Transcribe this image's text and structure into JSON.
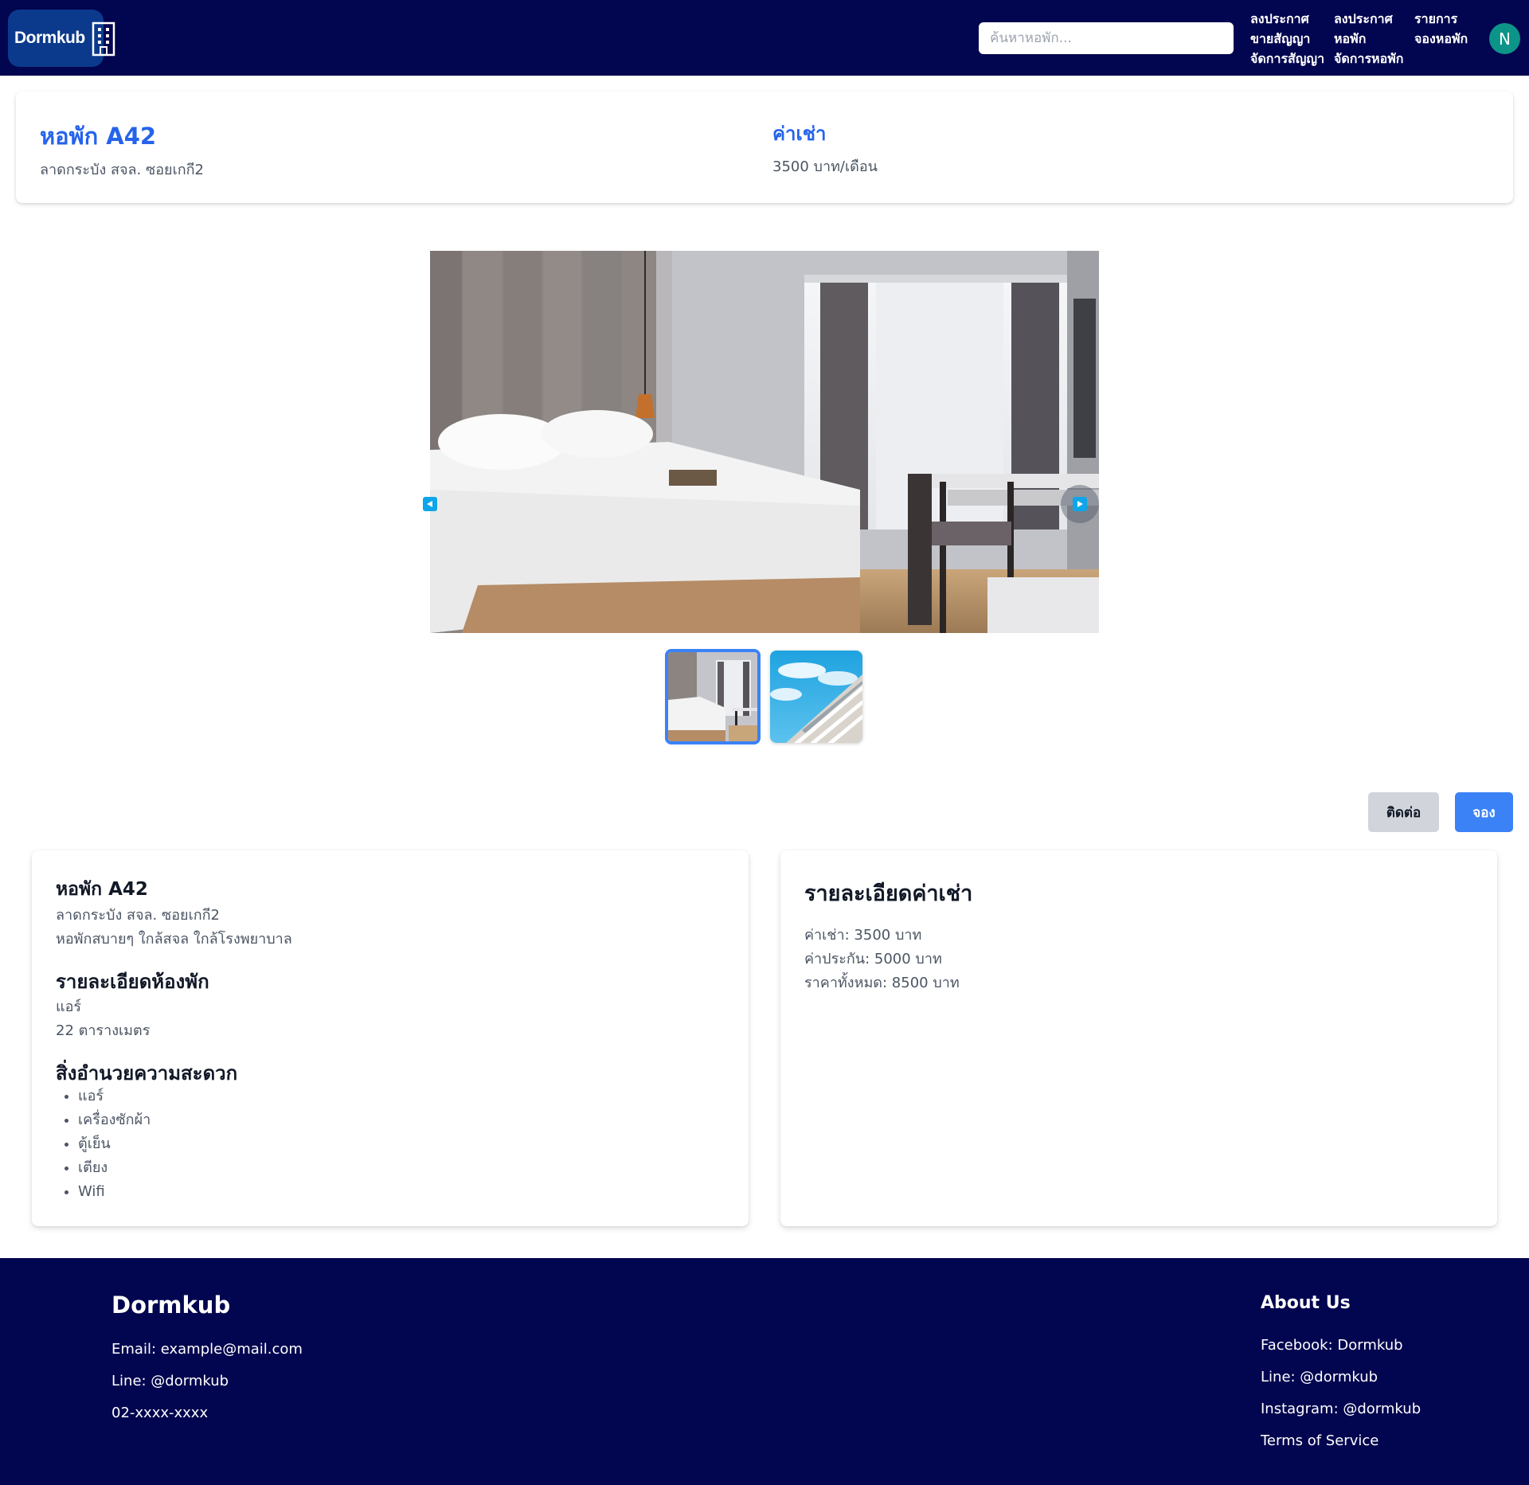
{
  "navbar": {
    "logo_text": "Dormkub",
    "search_placeholder": "ค้นหาหอพัก...",
    "links": [
      {
        "line1": "ลงประกาศ",
        "line2": "ขายสัญญา"
      },
      {
        "line1": "ลงประกาศ",
        "line2": "หอพัก"
      },
      {
        "line1": "รายการ",
        "line2": "จองหอพัก"
      }
    ],
    "links_row2": [
      "จัดการสัญญา",
      "จัดการหอพัก"
    ],
    "avatar_initial": "N"
  },
  "header": {
    "title": "หอพัก A42",
    "address": "ลาดกระบัง สจล. ซอยเกกี2",
    "rent_label": "ค่าเช่า",
    "rent_value": "3500 บาท/เดือน"
  },
  "gallery": {
    "prev_icon": "play-left-icon",
    "next_icon": "play-right-icon",
    "images": [
      "bedroom-photo",
      "building-exterior-photo"
    ],
    "selected_index": 0
  },
  "actions": {
    "contact_label": "ติดต่อ",
    "book_label": "จอง"
  },
  "details": {
    "name": "หอพัก A42",
    "address": "ลาดกระบัง สจล. ซอยเกกี2",
    "description": "หอพักสบายๆ ใกล้สจล ใกล้โรงพยาบาล",
    "room_heading": "รายละเอียดห้องพัก",
    "room_type": "แอร์",
    "room_size": "22 ตารางเมตร",
    "amenities_heading": "สิ่งอำนวยความสะดวก",
    "amenities": [
      "แอร์",
      "เครื่องซักผ้า",
      "ตู้เย็น",
      "เตียง",
      "Wifi"
    ]
  },
  "pricing": {
    "heading": "รายละเอียดค่าเช่า",
    "rent": "ค่าเช่า: 3500 บาท",
    "deposit": "ค่าประกัน: 5000 บาท",
    "total": "ราคาทั้งหมด: 8500 บาท"
  },
  "footer": {
    "brand": "Dormkub",
    "email": "Email: example@mail.com",
    "line": "Line: @dormkub",
    "phone": "02-xxxx-xxxx",
    "about_heading": "About Us",
    "facebook": "Facebook: Dormkub",
    "about_line": "Line: @dormkub",
    "instagram": "Instagram: @dormkub",
    "terms": "Terms of Service"
  },
  "colors": {
    "navbar_bg": "#02054f",
    "accent_blue": "#2563eb",
    "book_button": "#3b82f6",
    "contact_button": "#d1d5db",
    "avatar_bg": "#0d9488"
  }
}
